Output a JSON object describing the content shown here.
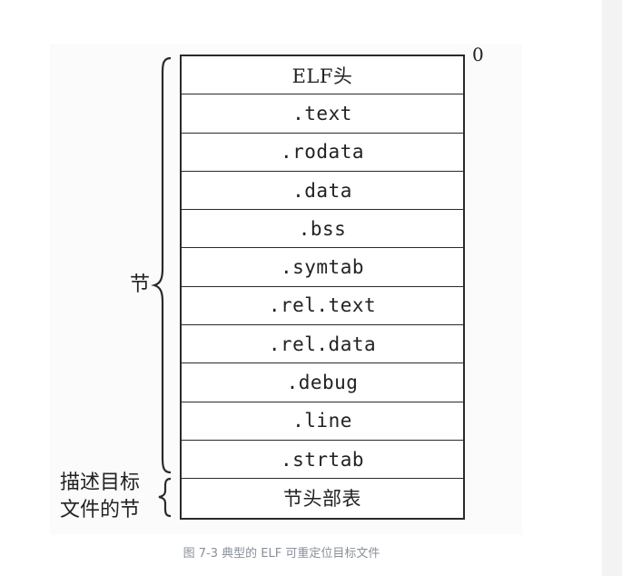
{
  "figure": {
    "offset_label": "0",
    "sections": [
      ".text",
      ".rodata",
      ".data",
      ".bss",
      ".symtab",
      ".rel.text",
      ".rel.data",
      ".debug",
      ".line",
      ".strtab"
    ],
    "header_row": "ELF头",
    "footer_row": "节头部表",
    "sections_brace_label": "节",
    "descriptor_label_line1": "描述目标",
    "descriptor_label_line2": "文件的节"
  },
  "caption": "图 7-3 典型的 ELF 可重定位目标文件"
}
